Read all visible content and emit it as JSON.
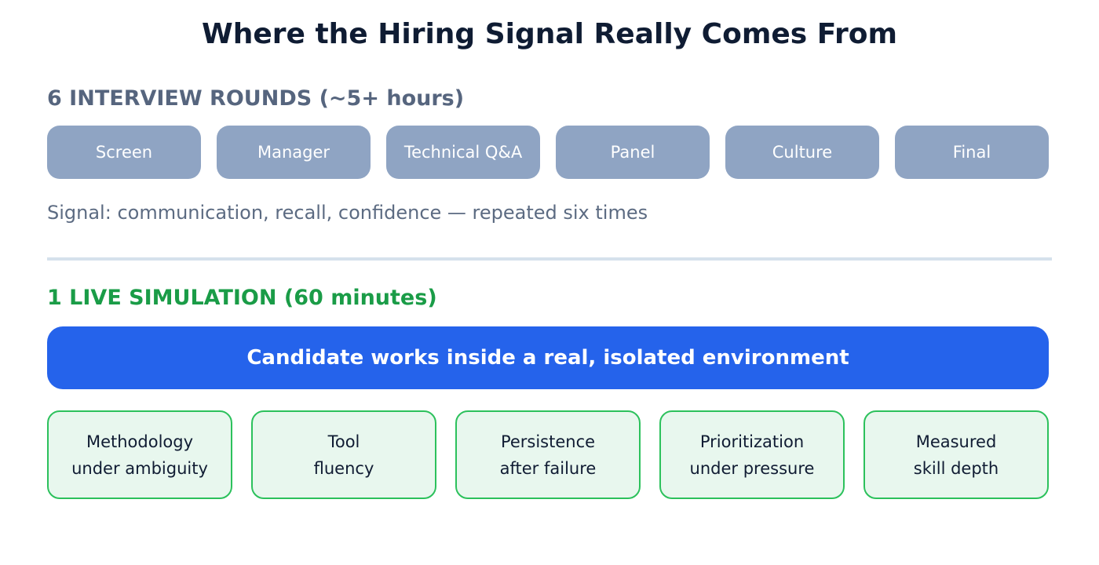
{
  "title": "Where the Hiring Signal Really Comes From",
  "interview": {
    "heading": "6 INTERVIEW ROUNDS (~5+ hours)",
    "rounds": [
      "Screen",
      "Manager",
      "Technical Q&A",
      "Panel",
      "Culture",
      "Final"
    ],
    "signal": "Signal: communication, recall, confidence — repeated six times"
  },
  "simulation": {
    "heading": "1 LIVE SIMULATION (60 minutes)",
    "environment": "Candidate works inside a real, isolated environment",
    "skills": [
      {
        "line1": "Methodology",
        "line2": "under ambiguity"
      },
      {
        "line1": "Tool",
        "line2": "fluency"
      },
      {
        "line1": "Persistence",
        "line2": "after failure"
      },
      {
        "line1": "Prioritization",
        "line2": "under pressure"
      },
      {
        "line1": "Measured",
        "line2": "skill depth"
      }
    ]
  },
  "colors": {
    "title": "#0f1c33",
    "interview_heading": "#56657e",
    "round_fill": "#8fa4c3",
    "simulation_heading": "#1a9c47",
    "environment_fill": "#2563eb",
    "skill_fill": "#e8f7ee",
    "skill_border": "#2cc15c",
    "divider": "#d5e1ec"
  }
}
